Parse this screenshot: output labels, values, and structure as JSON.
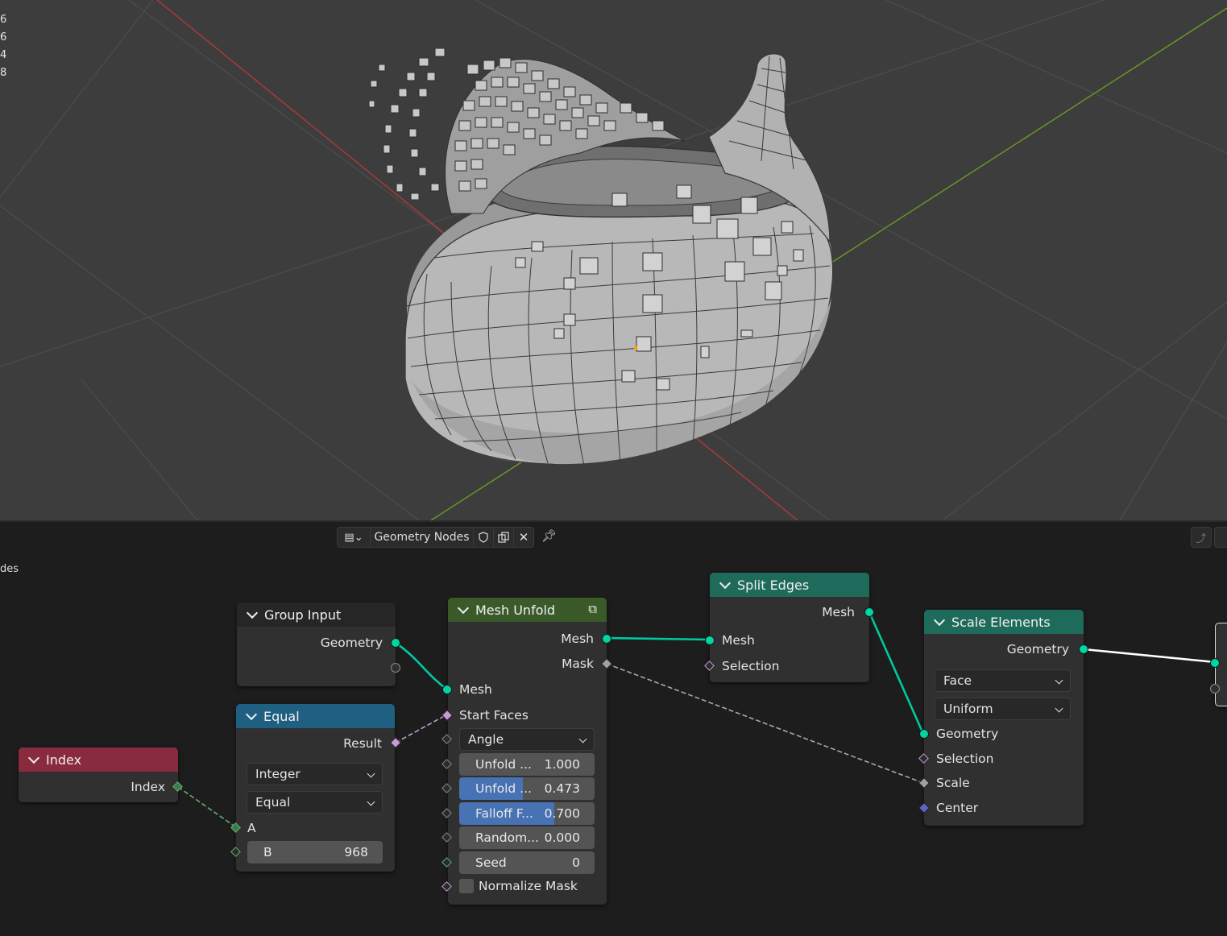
{
  "viewport": {
    "stats": [
      "6",
      "6",
      "4",
      "8"
    ],
    "colors": {
      "background": "#3d3d3d",
      "x_axis": "#b03a3a",
      "y_axis": "#6a9a25"
    }
  },
  "editor": {
    "tree_name": "Geometry Nodes",
    "side_label": "des",
    "icons": [
      "editor-type-icon",
      "fake-user-shield-icon",
      "duplicate-icon",
      "close-icon",
      "pin-icon"
    ]
  },
  "nodes": {
    "index": {
      "title": "Index",
      "outputs": [
        "Index"
      ],
      "color": "#8a2a3e"
    },
    "group_input": {
      "title": "Group Input",
      "outputs": [
        "Geometry"
      ]
    },
    "equal": {
      "title": "Equal",
      "outputs": [
        "Result"
      ],
      "data_type": "Integer",
      "operation": "Equal",
      "inputs": [
        "A"
      ],
      "b_label": "B",
      "b_value": "968",
      "color": "#1f5f82"
    },
    "mesh_unfold": {
      "title": "Mesh Unfold",
      "outputs": [
        "Mesh",
        "Mask"
      ],
      "inputs": [
        "Mesh",
        "Start Faces"
      ],
      "method": "Angle",
      "fields": [
        {
          "label": "Unfold ...",
          "value": "1.000",
          "fill": 0
        },
        {
          "label": "Unfold ...",
          "value": "0.473",
          "fill": 0.473
        },
        {
          "label": "Falloff F...",
          "value": "0.700",
          "fill": 0.7
        },
        {
          "label": "Random...",
          "value": "0.000",
          "fill": 0
        },
        {
          "label": "Seed",
          "value": "0",
          "fill": 0
        }
      ],
      "normalize_label": "Normalize Mask",
      "normalize_checked": false,
      "color": "#3b5a2a"
    },
    "split_edges": {
      "title": "Split Edges",
      "outputs": [
        "Mesh"
      ],
      "inputs": [
        "Mesh",
        "Selection"
      ],
      "color": "#1e6b5c"
    },
    "scale_elements": {
      "title": "Scale Elements",
      "outputs": [
        "Geometry"
      ],
      "domain": "Face",
      "scale_mode": "Uniform",
      "inputs": [
        "Geometry",
        "Selection",
        "Scale",
        "Center"
      ],
      "color": "#1e6b5c"
    }
  }
}
